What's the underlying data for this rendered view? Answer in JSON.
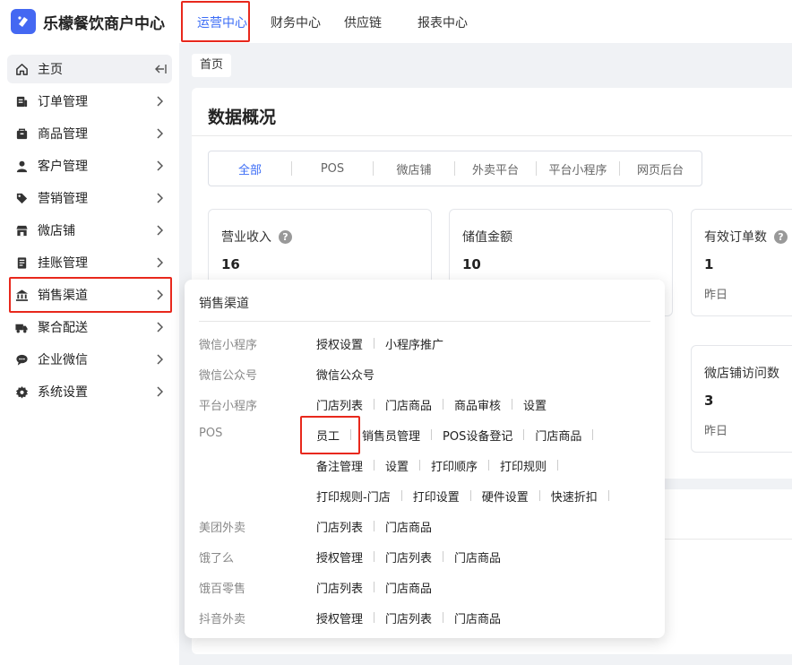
{
  "brand": {
    "name": "乐檬餐饮商户中心"
  },
  "top_nav": [
    {
      "label": "运营中心",
      "active": true
    },
    {
      "label": "财务中心"
    },
    {
      "label": "供应链"
    },
    {
      "label": "报表中心"
    }
  ],
  "sidebar": {
    "items": [
      {
        "label": "主页",
        "icon": "home-icon"
      },
      {
        "label": "订单管理",
        "icon": "order-icon"
      },
      {
        "label": "商品管理",
        "icon": "goods-icon"
      },
      {
        "label": "客户管理",
        "icon": "user-icon"
      },
      {
        "label": "营销管理",
        "icon": "tag-icon"
      },
      {
        "label": "微店铺",
        "icon": "store-icon"
      },
      {
        "label": "挂账管理",
        "icon": "ledger-icon"
      },
      {
        "label": "销售渠道",
        "icon": "bank-icon"
      },
      {
        "label": "聚合配送",
        "icon": "truck-icon"
      },
      {
        "label": "企业微信",
        "icon": "chat-icon"
      },
      {
        "label": "系统设置",
        "icon": "gear-icon"
      }
    ]
  },
  "breadcrumb": {
    "label": "首页"
  },
  "overview": {
    "title": "数据概况",
    "tabs": [
      "全部",
      "POS",
      "微店铺",
      "外卖平台",
      "平台小程序",
      "网页后台"
    ],
    "active_tab": "全部",
    "stats": [
      {
        "label": "营业收入",
        "value": "16",
        "help": true
      },
      {
        "label": "储值金额",
        "value": "10"
      },
      {
        "label": "有效订单数",
        "value": "1",
        "sub": "昨日",
        "help": true
      },
      {
        "label": "微店铺访问数",
        "value": "3",
        "sub": "昨日"
      }
    ]
  },
  "flyout": {
    "title": "销售渠道",
    "rows": [
      {
        "category": "微信小程序",
        "links": [
          "授权设置",
          "小程序推广"
        ]
      },
      {
        "category": "微信公众号",
        "links": [
          "微信公众号"
        ]
      },
      {
        "category": "平台小程序",
        "links": [
          "门店列表",
          "门店商品",
          "商品审核",
          "设置"
        ]
      },
      {
        "category": "POS",
        "links": [
          "员工",
          "销售员管理",
          "POS设备登记",
          "门店商品"
        ]
      },
      {
        "category": "",
        "links": [
          "备注管理",
          "设置",
          "打印顺序",
          "打印规则"
        ]
      },
      {
        "category": "",
        "links": [
          "打印规则-门店",
          "打印设置",
          "硬件设置",
          "快速折扣"
        ]
      },
      {
        "category": "美团外卖",
        "links": [
          "门店列表",
          "门店商品"
        ]
      },
      {
        "category": "饿了么",
        "links": [
          "授权管理",
          "门店列表",
          "门店商品"
        ]
      },
      {
        "category": "饿百零售",
        "links": [
          "门店列表",
          "门店商品"
        ]
      },
      {
        "category": "抖音外卖",
        "links": [
          "授权管理",
          "门店列表",
          "门店商品"
        ]
      }
    ]
  },
  "colors": {
    "accent": "#3b6cf6",
    "highlight": "#e8281c",
    "logo": "#4468f2"
  }
}
